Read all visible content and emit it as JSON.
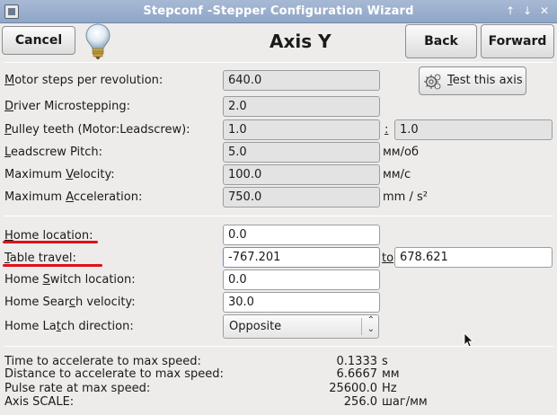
{
  "window": {
    "title": "Stepconf -Stepper Configuration Wizard",
    "btn_up": "↑",
    "btn_down": "↓",
    "btn_close": "✕"
  },
  "header": {
    "cancel_label": "Cancel",
    "axis_title": "Axis Y",
    "back_label": "Back",
    "forward_label": "Forward"
  },
  "motor": {
    "steps_rev": {
      "mnemonic": "M",
      "rest": "otor steps per revolution:",
      "value": "640.0"
    },
    "microstep": {
      "mnemonic": "D",
      "rest": "river Microstepping:",
      "value": "2.0"
    },
    "pulley": {
      "mnemonic": "P",
      "rest": "ulley teeth (Motor:Leadscrew):",
      "value_a": "1.0",
      "separator": ":",
      "value_b": "1.0"
    },
    "pitch": {
      "mnemonic": "L",
      "rest": "eadscrew Pitch:",
      "value": "5.0",
      "unit": "мм/об"
    },
    "velocity": {
      "pre": "Maximum ",
      "mnemonic": "V",
      "rest": "elocity:",
      "value": "100.0",
      "unit": "мм/с"
    },
    "accel": {
      "pre": "Maximum ",
      "mnemonic": "A",
      "rest": "cceleration:",
      "value": "750.0",
      "unit": "mm / s²"
    },
    "test_pre": "",
    "test_mnemonic": "T",
    "test_rest": "est this axis"
  },
  "homing": {
    "home_location": {
      "mnemonic": "H",
      "rest": "ome location:",
      "value": "0.0"
    },
    "table_travel": {
      "mnemonic": "T",
      "rest": "able travel:",
      "value_min": "-767.201",
      "to_label": "to",
      "value_max": "678.621"
    },
    "switch_location": {
      "pre": "Home ",
      "mnemonic": "S",
      "rest": "witch location:",
      "value": "0.0"
    },
    "search_velocity": {
      "pre": "Home Sear",
      "mnemonic": "c",
      "rest": "h velocity:",
      "value": "30.0"
    },
    "latch_direction": {
      "pre": "Home La",
      "mnemonic": "t",
      "rest": "ch direction:",
      "value": "Opposite"
    }
  },
  "stats": [
    {
      "label": "Time to accelerate to max speed:",
      "value": "0.1333",
      "unit": "s"
    },
    {
      "label": "Distance to accelerate to max speed:",
      "value": "6.6667",
      "unit": "мм"
    },
    {
      "label": "Pulse rate at max speed:",
      "value": "25600.0",
      "unit": "Hz"
    },
    {
      "label": "Axis SCALE:",
      "value": "256.0",
      "unit": "шаг/мм"
    }
  ],
  "colors": {
    "titlebar": "#98adcc",
    "annotation_underline": "#e0101a"
  },
  "icons": [
    "lightbulb-icon",
    "gear-icon",
    "window-icon",
    "mouse-cursor-icon"
  ]
}
